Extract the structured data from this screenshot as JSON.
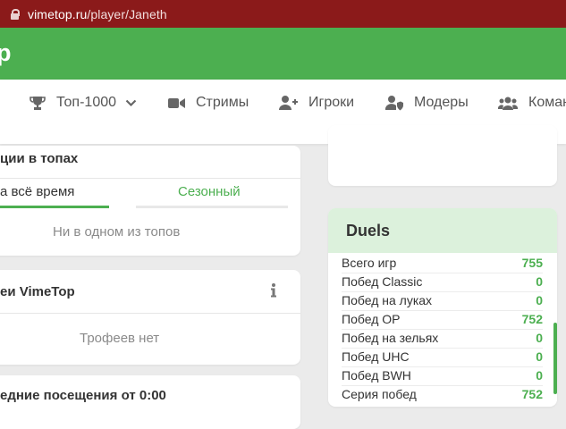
{
  "browser": {
    "url_host": "vimetop.ru",
    "url_path": "/player/Janeth"
  },
  "header": {
    "logo_fragment": "p"
  },
  "nav": {
    "items": [
      {
        "label": "Топ-1000",
        "icon": "trophy-icon",
        "has_dropdown": true
      },
      {
        "label": "Стримы",
        "icon": "video-camera-icon"
      },
      {
        "label": "Игроки",
        "icon": "user-plus-icon"
      },
      {
        "label": "Модеры",
        "icon": "user-shield-icon"
      },
      {
        "label": "Коман",
        "icon": "users-icon"
      }
    ]
  },
  "positions_card": {
    "title": "ции в топах",
    "tabs": [
      {
        "label": "а всё время",
        "active": true
      },
      {
        "label": "Сезонный",
        "active": false
      }
    ],
    "empty_text": "Ни в одном из топов"
  },
  "trophies_card": {
    "title": "еи VimeTop",
    "info_icon": "info-icon",
    "empty_text": "Трофеев нет"
  },
  "visits_card": {
    "title": "едние посещения от 0:00"
  },
  "duels": {
    "title": "Duels",
    "stats": [
      {
        "label": "Всего игр",
        "value": "755"
      },
      {
        "label": "Побед Classic",
        "value": "0"
      },
      {
        "label": "Побед на луках",
        "value": "0"
      },
      {
        "label": "Побед OP",
        "value": "752"
      },
      {
        "label": "Побед на зельях",
        "value": "0"
      },
      {
        "label": "Побед UHC",
        "value": "0"
      },
      {
        "label": "Побед BWH",
        "value": "0"
      },
      {
        "label": "Серия побед",
        "value": "752"
      }
    ]
  },
  "colors": {
    "brand_green": "#4caf50",
    "address_bar": "#8b1a1a",
    "duels_header": "#dcf1dc"
  }
}
